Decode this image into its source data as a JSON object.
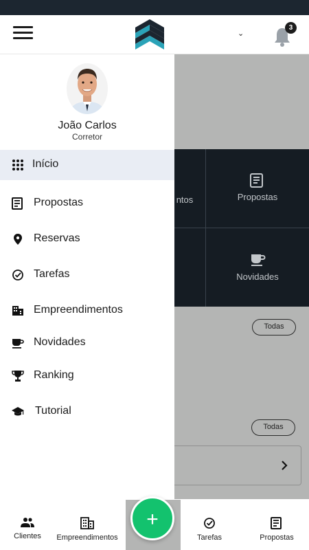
{
  "header": {
    "notification_count": "3",
    "dropdown_glyph": "⌄"
  },
  "user": {
    "name": "João Carlos",
    "role": "Corretor"
  },
  "menu": [
    {
      "label": "Início",
      "icon": "grid-icon",
      "active": true
    },
    {
      "label": "Propostas",
      "icon": "document-icon"
    },
    {
      "label": "Reservas",
      "icon": "location-pin-icon"
    },
    {
      "label": "Tarefas",
      "icon": "check-circle-icon"
    },
    {
      "label": "Empreendimentos",
      "icon": "building-icon"
    },
    {
      "label": "Novidades",
      "icon": "coffee-cup-icon"
    },
    {
      "label": "Ranking",
      "icon": "trophy-icon"
    },
    {
      "label": "Tutorial",
      "icon": "graduation-cap-icon"
    }
  ],
  "dashboard": {
    "tile_partial": "ntos",
    "tile_propostas": "Propostas",
    "tile_novidades": "Novidades",
    "todas_1": "Todas",
    "todas_2": "Todas"
  },
  "bottom_nav": {
    "clientes": "Clientes",
    "empreendimentos": "Empreendimentos",
    "fab": "+",
    "tarefas": "Tarefas",
    "propostas": "Propostas"
  },
  "colors": {
    "status_bar": "#1c2630",
    "logo_teal": "#2aa3b8",
    "logo_dark": "#1c2630",
    "fab_green": "#13c26e",
    "active_menu_bg": "#e9edf4"
  }
}
